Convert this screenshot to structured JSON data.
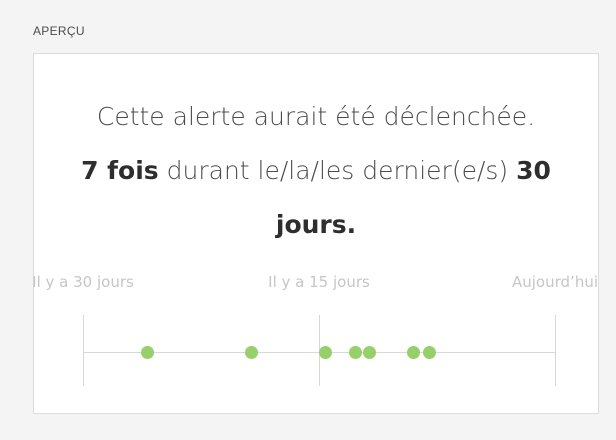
{
  "section": {
    "label": "APERÇU"
  },
  "preview": {
    "line1": "Cette alerte aurait été déclenchée.",
    "count_text": "7 fois",
    "middle_text": " durant le/la/les dernier(e/s) ",
    "days_text": "30",
    "end_text": "jours."
  },
  "timeline": {
    "total_days": 30,
    "accent_color": "#97cf6a",
    "ticks": [
      {
        "label": "Il y a 30 jours",
        "days_ago": 30
      },
      {
        "label": "Il y a 15 jours",
        "days_ago": 15
      },
      {
        "label": "Aujourd’hui",
        "days_ago": 0
      }
    ],
    "events_days_ago": [
      25.9,
      19.3,
      14.6,
      12.7,
      11.8,
      9.0,
      8.0
    ]
  }
}
